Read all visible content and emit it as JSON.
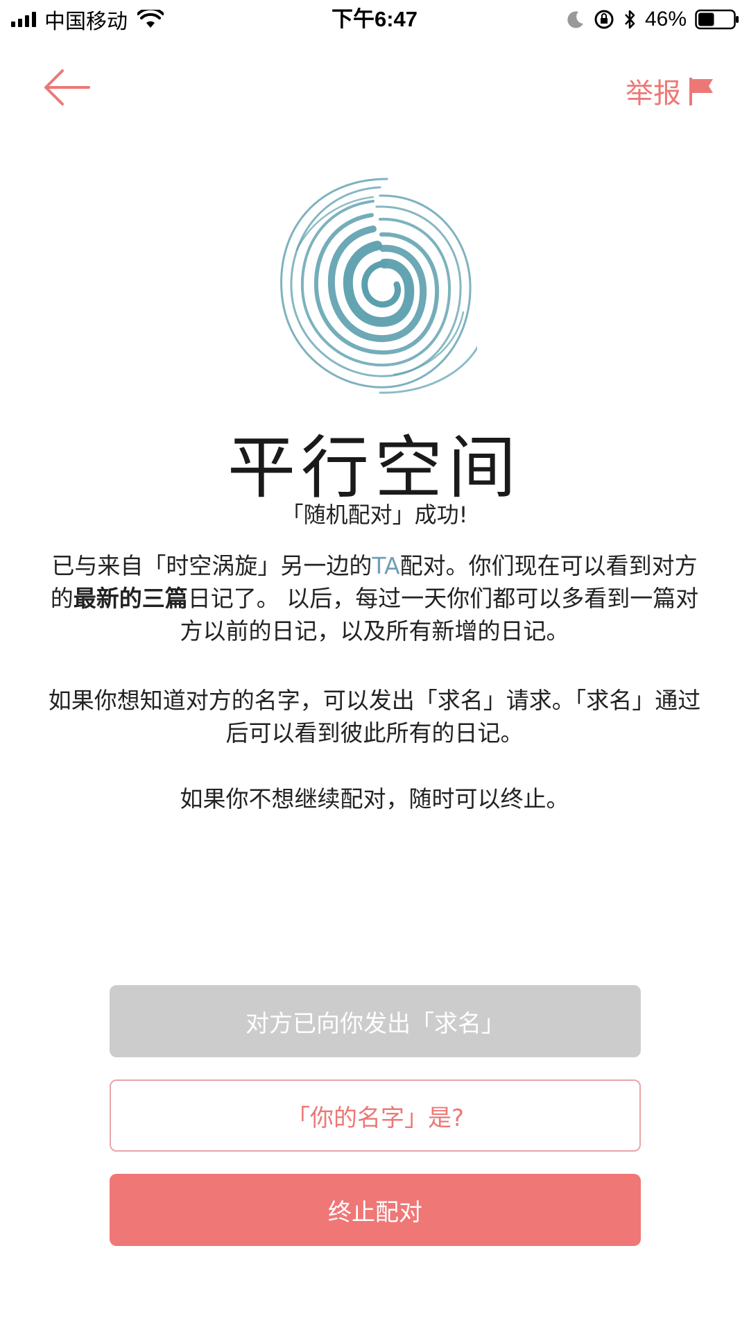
{
  "status_bar": {
    "carrier": "中国移动",
    "time": "下午6:47",
    "battery_percent": "46%",
    "battery_level": 0.46
  },
  "nav": {
    "back_icon": "arrow-left-icon",
    "report_label": "举报",
    "report_icon": "flag-icon",
    "accent_color": "#ec7876"
  },
  "header": {
    "logo_icon": "vortex-icon",
    "logo_color": "#5c9fae",
    "title": "平行空间",
    "subtitle": "「随机配对」成功!"
  },
  "body": {
    "para1": {
      "part1": "已与来自「时空涡旋」另一边的",
      "ta": "TA",
      "part2": "配对。你们现在可以看到对方的",
      "bold": "最新的三篇",
      "part3": "日记了。 以后，每过一天你们都可以多看到一篇对方以前的日记，以及所有新增的日记。"
    },
    "para2": "如果你想知道对方的名字，可以发出「求名」请求。「求名」通过后可以看到彼此所有的日记。",
    "para3": "如果你不想继续配对，随时可以终止。"
  },
  "buttons": {
    "request_label": "对方已向你发出「求名」",
    "name_label": "「你的名字」是?",
    "end_label": "终止配对"
  }
}
